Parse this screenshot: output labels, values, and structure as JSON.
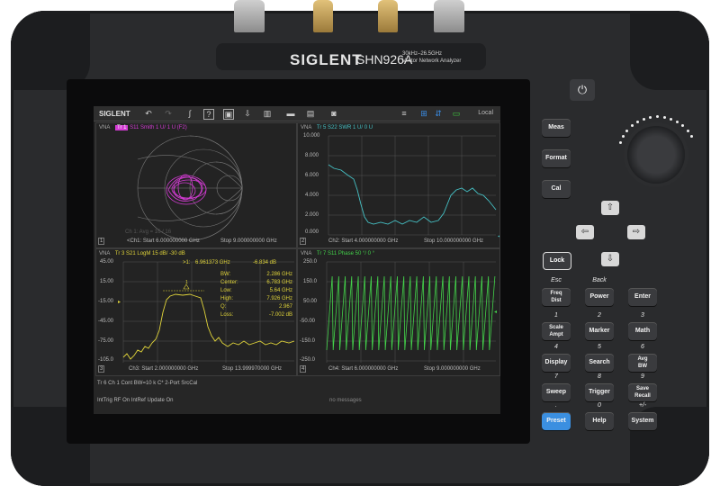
{
  "device": {
    "brand": "SIGLENT",
    "model": "SHN926A",
    "spec_line1": "30kHz–26.5GHz",
    "spec_line2": "Vector Network Analyzer"
  },
  "toolbar": {
    "logo": "SIGLENT",
    "mode": "Local"
  },
  "panes": [
    {
      "id": "1",
      "instrument": "VNA",
      "trace": "Tr 1",
      "title": "S11 Smith 1 U/ 1 U (F2)",
      "overlay": "Ch 1: Avg = 16 / 16",
      "footer_left": "<Ch1: Start 6.000000000 GHz",
      "footer_right": "Stop 9.000000000 GHz",
      "color": "#d23bd2"
    },
    {
      "id": "2",
      "instrument": "VNA",
      "trace": "Tr 5",
      "title": "S22 SWR 1 U/ 0 U",
      "footer_left": "Ch2: Start 4.000000000 GHz",
      "footer_right": "Stop 10.000000000 GHz",
      "y_ticks": [
        "10.000",
        "8.000",
        "6.000",
        "4.000",
        "2.000",
        "0.000"
      ],
      "color": "#46c2c6"
    },
    {
      "id": "3",
      "instrument": "VNA",
      "trace": "Tr 3",
      "title": "S21 LogM 15 dB/ -30 dB",
      "footer_left": "Ch3: Start 2.000000000 GHz",
      "footer_right": "Stop 13.999970000 GHz",
      "y_ticks": [
        "45.00",
        "15.00",
        "-15.00",
        "-45.00",
        "-75.00",
        "-105.0"
      ],
      "color": "#e0d43a",
      "marker": {
        "label": ">1:",
        "freq": "6.961373 GHz",
        "value": "-6.834 dB"
      },
      "stats": [
        {
          "key": "BW:",
          "val": "2.286 GHz"
        },
        {
          "key": "Center:",
          "val": "6.783 GHz"
        },
        {
          "key": "Low:",
          "val": "5.64 GHz"
        },
        {
          "key": "High:",
          "val": "7.926 GHz"
        },
        {
          "key": "Q:",
          "val": "2.967"
        },
        {
          "key": "Loss:",
          "val": "-7.002 dB"
        }
      ]
    },
    {
      "id": "4",
      "instrument": "VNA",
      "trace": "Tr 7",
      "title": "S11 Phase 50 °/ 0 °",
      "footer_left": "Ch4: Start 6.000000000 GHz",
      "footer_right": "Stop 9.000000000 GHz",
      "y_ticks": [
        "250.0",
        "150.0",
        "50.00",
        "-50.00",
        "-150.0",
        "-250.0"
      ],
      "color": "#43d34a"
    }
  ],
  "status": {
    "line1": "Tr 6   Ch 1   Cont   BW=10 k   C* 2-Port   SrcCal",
    "line2": "IntTrig   RF On   IntRef   Update On",
    "messages": "no messages"
  },
  "keys": {
    "meas": "Meas",
    "format": "Format",
    "cal": "Cal",
    "lock": "Lock",
    "esc_label": "Esc",
    "back_label": "Back",
    "freq_dist_1": "Freq",
    "freq_dist_2": "Dist",
    "power": "Power",
    "enter": "Enter",
    "n1": "1",
    "n2": "2",
    "n3": "3",
    "scale_1": "Scale",
    "scale_2": "Ampt",
    "marker": "Marker",
    "math": "Math",
    "n4": "4",
    "n5": "5",
    "n6": "6",
    "display": "Display",
    "search": "Search",
    "avg_1": "Avg",
    "avg_2": "BW",
    "n7": "7",
    "n8": "8",
    "n9": "9",
    "sweep": "Sweep",
    "trigger": "Trigger",
    "save_1": "Save",
    "save_2": "Recall",
    "dot": ".",
    "n0": "0",
    "pm": "+/-",
    "preset": "Preset",
    "help": "Help",
    "system": "System"
  }
}
